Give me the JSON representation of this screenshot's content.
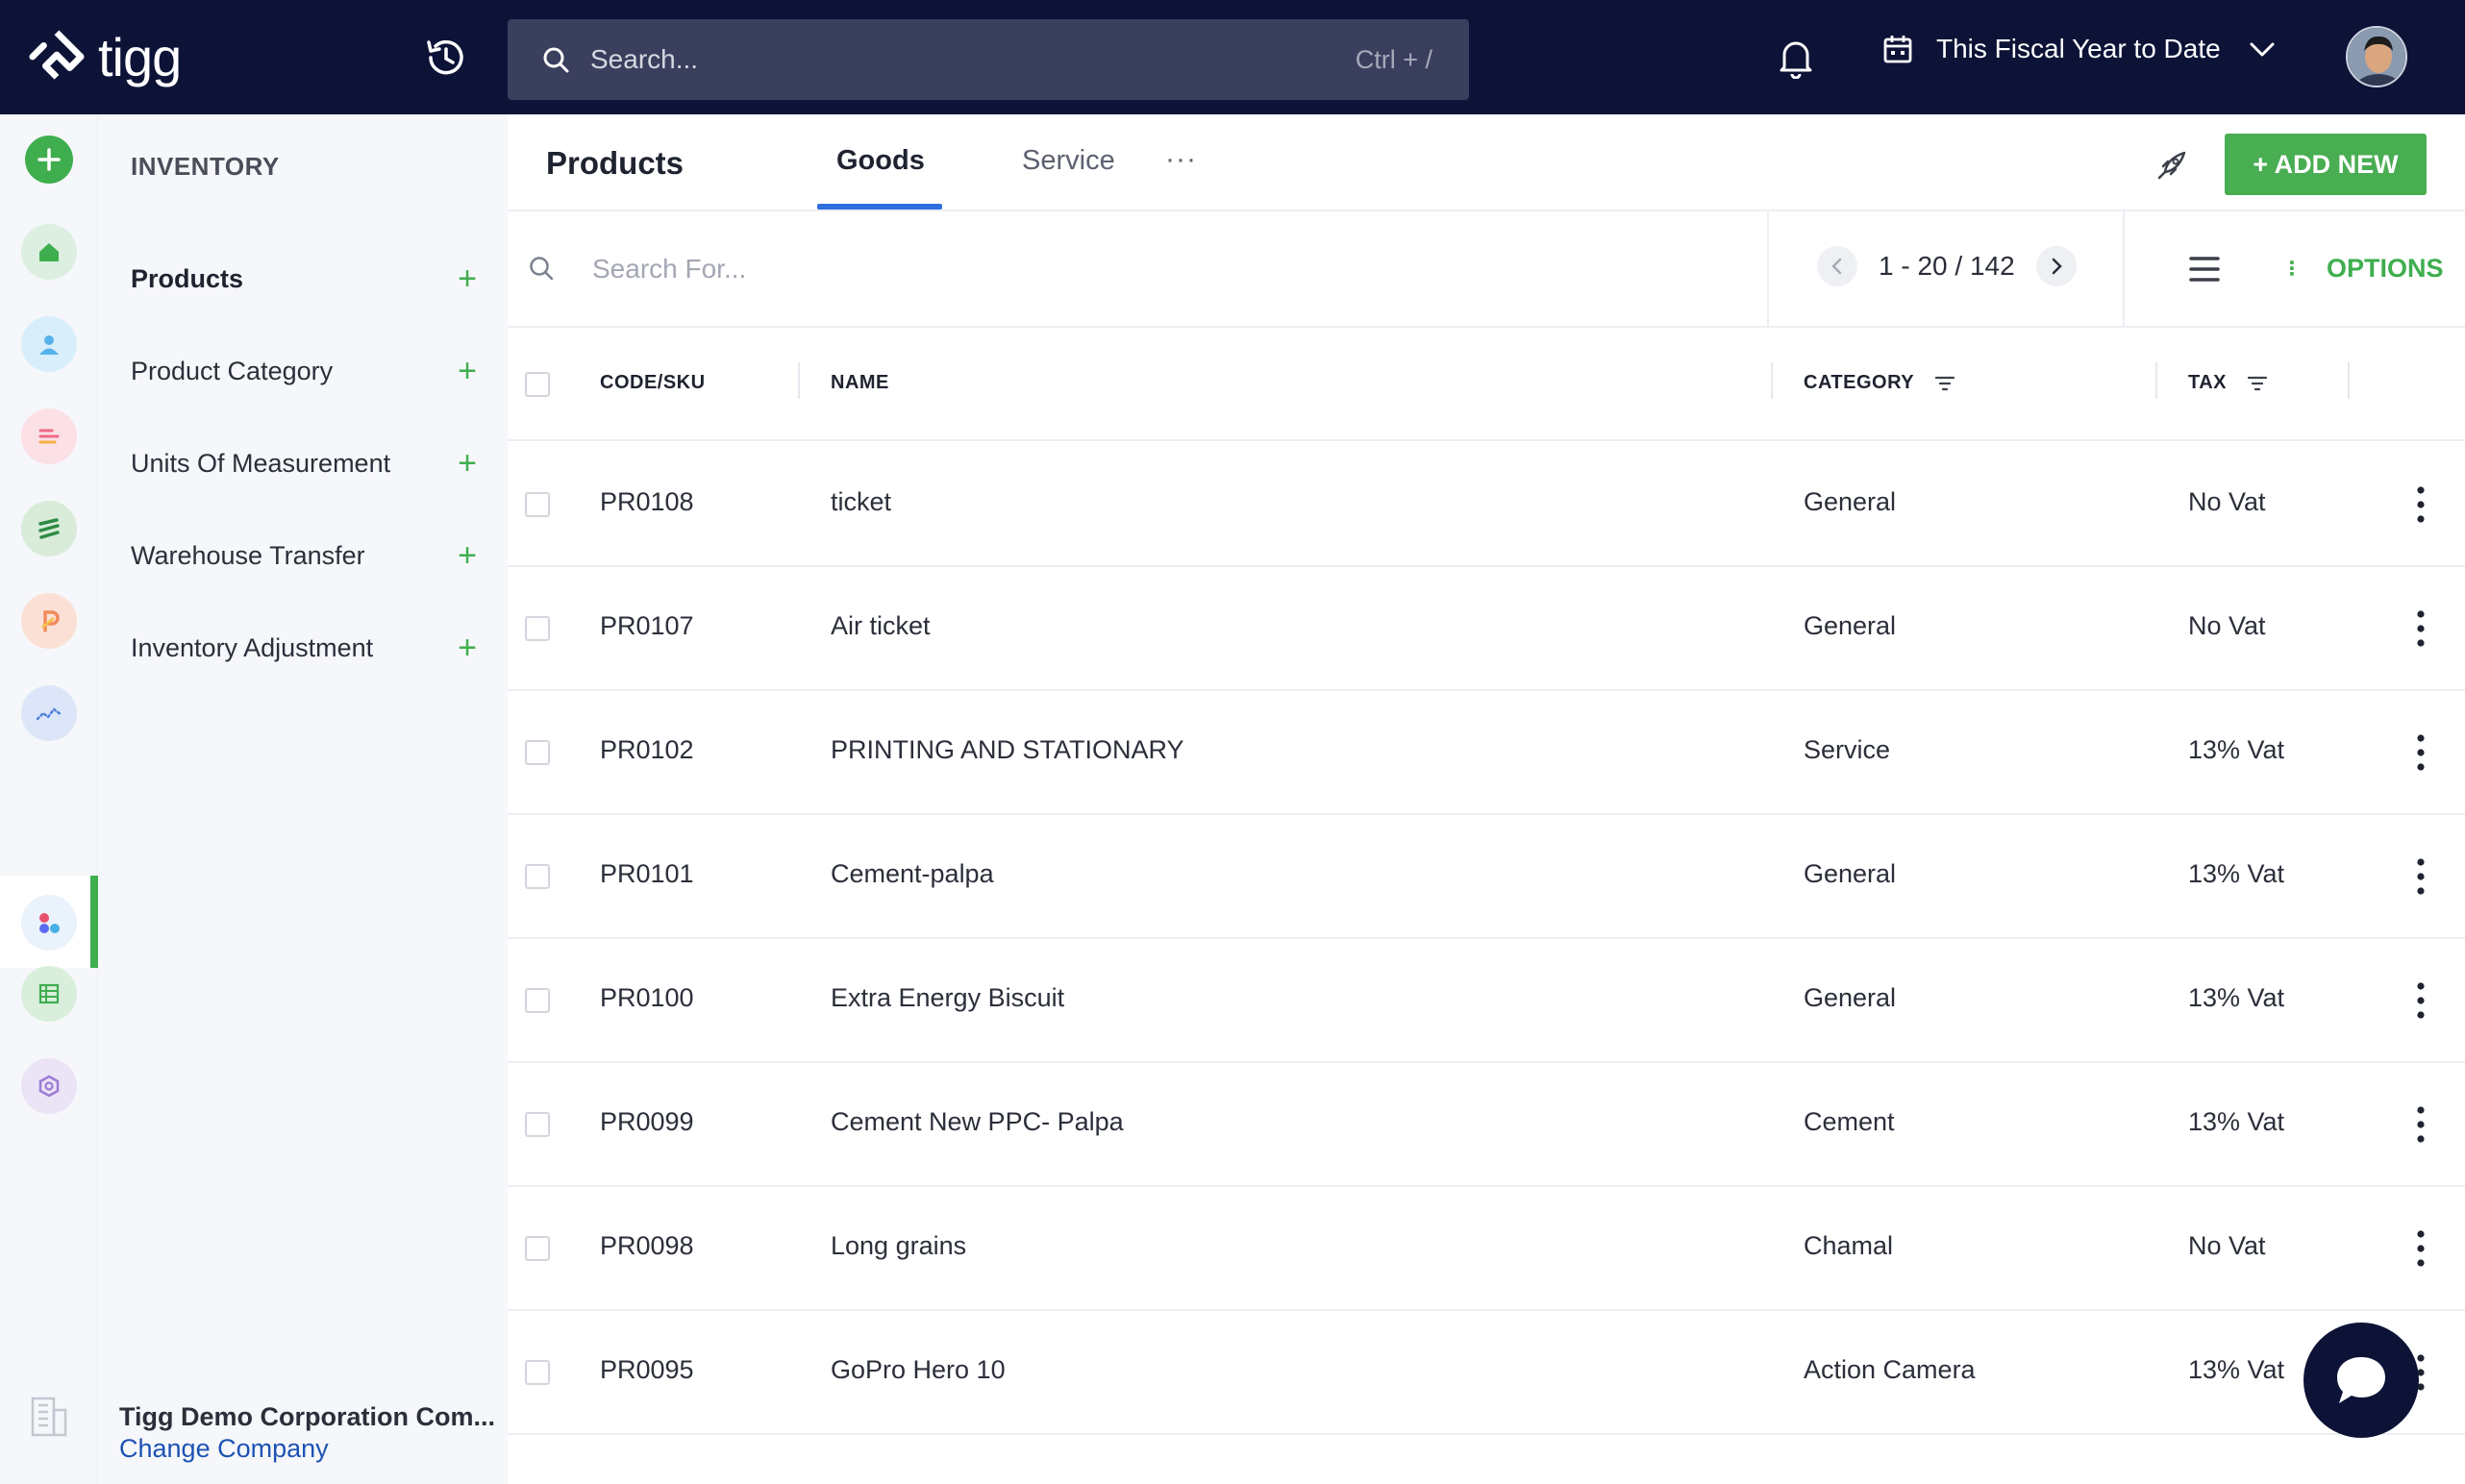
{
  "app": {
    "logo_text": "tigg"
  },
  "topbar": {
    "search_placeholder": "Search...",
    "search_shortcut": "Ctrl + /",
    "period_label": "This Fiscal Year to Date"
  },
  "sidebar": {
    "heading": "INVENTORY",
    "items": [
      {
        "label": "Products"
      },
      {
        "label": "Product Category"
      },
      {
        "label": "Units Of Measurement"
      },
      {
        "label": "Warehouse Transfer"
      },
      {
        "label": "Inventory Adjustment"
      }
    ],
    "company_name": "Tigg Demo Corporation Com...",
    "change_company": "Change Company"
  },
  "main": {
    "title": "Products",
    "tabs": [
      {
        "label": "Goods"
      },
      {
        "label": "Service"
      }
    ],
    "more_label": "···",
    "add_new_label": "+ ADD NEW",
    "search_placeholder": "Search For...",
    "pagination": "1 - 20 / 142",
    "options_label": "OPTIONS"
  },
  "table": {
    "columns": [
      "CODE/SKU",
      "NAME",
      "CATEGORY",
      "TAX"
    ],
    "rows": [
      {
        "code": "PR0108",
        "name": "ticket",
        "category": "General",
        "tax": "No Vat"
      },
      {
        "code": "PR0107",
        "name": "Air ticket",
        "category": "General",
        "tax": "No Vat"
      },
      {
        "code": "PR0102",
        "name": "PRINTING AND STATIONARY",
        "category": "Service",
        "tax": "13% Vat"
      },
      {
        "code": "PR0101",
        "name": "Cement-palpa",
        "category": "General",
        "tax": "13% Vat"
      },
      {
        "code": "PR0100",
        "name": "Extra Energy Biscuit",
        "category": "General",
        "tax": "13% Vat"
      },
      {
        "code": "PR0099",
        "name": "Cement New PPC- Palpa",
        "category": "Cement",
        "tax": "13% Vat"
      },
      {
        "code": "PR0098",
        "name": "Long grains",
        "category": "Chamal",
        "tax": "No Vat"
      },
      {
        "code": "PR0095",
        "name": "GoPro Hero 10",
        "category": "Action Camera",
        "tax": "13% Vat"
      }
    ]
  },
  "colors": {
    "topbar": "#0c1337",
    "accent_green": "#49ad52",
    "tab_underline": "#2f6fe0",
    "link_blue": "#1d52b3"
  },
  "icons": [
    "tigg-logo-icon",
    "history-icon",
    "search-icon",
    "bell-icon",
    "calendar-icon",
    "chevron-down-icon",
    "plus-circle-icon",
    "home-icon",
    "user-icon",
    "list-icon",
    "sales-icon",
    "purchase-icon",
    "chart-icon",
    "inventory-icon",
    "table-icon",
    "settings-icon",
    "building-icon",
    "rocket-icon",
    "menu-icon",
    "kebab-icon",
    "chat-icon"
  ]
}
